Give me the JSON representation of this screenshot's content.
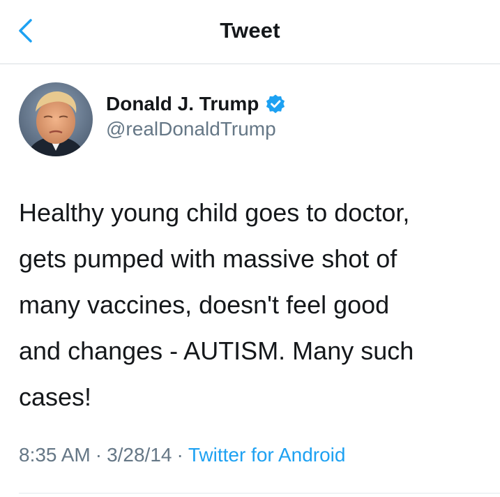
{
  "header": {
    "title": "Tweet",
    "back_icon": "chevron-left-icon"
  },
  "author": {
    "display_name": "Donald J. Trump",
    "handle": "@realDonaldTrump",
    "verified_icon": "verified-badge-icon"
  },
  "tweet": {
    "text": "Healthy young child goes to doctor,\ngets pumped with massive shot of\nmany vaccines, doesn't feel good\nand changes - AUTISM. Many such\ncases!"
  },
  "meta": {
    "time": "8:35 AM",
    "date": "3/28/14",
    "source": "Twitter for Android",
    "separator": "·"
  },
  "colors": {
    "accent": "#1da1f2",
    "text": "#14171a",
    "secondary": "#657786",
    "divider": "#d8dde1"
  }
}
